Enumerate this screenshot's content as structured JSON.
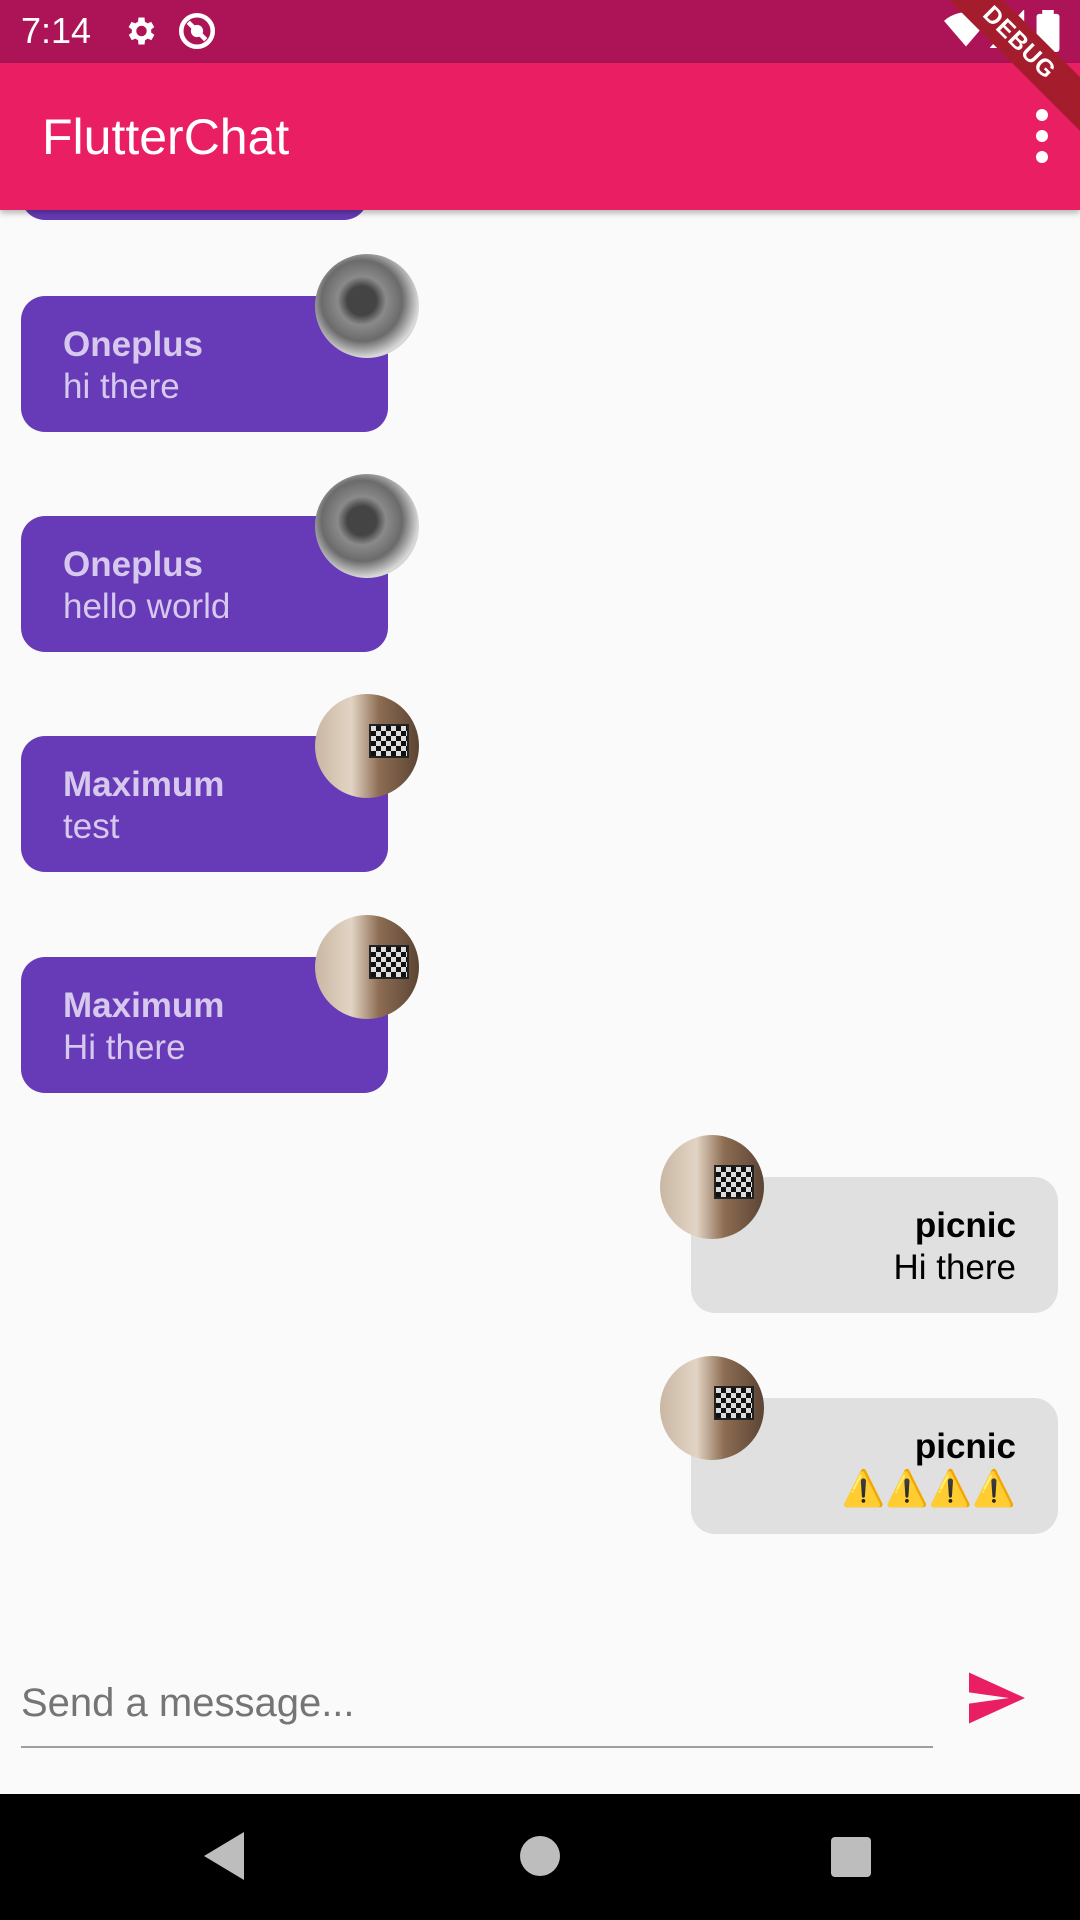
{
  "status_bar": {
    "time": "7:14",
    "icons": [
      "settings-icon",
      "sync-icon",
      "wifi-icon",
      "signal-icon",
      "battery-icon"
    ]
  },
  "debug_banner": "DEBUG",
  "app_bar": {
    "title": "FlutterChat",
    "menu_icon": "more-vert-icon"
  },
  "messages": [
    {
      "user": "Oneplus",
      "text": "hi there",
      "is_me": false,
      "avatar": "phone"
    },
    {
      "user": "Oneplus",
      "text": "hello world",
      "is_me": false,
      "avatar": "phone"
    },
    {
      "user": "Maximum",
      "text": "test",
      "is_me": false,
      "avatar": "room"
    },
    {
      "user": "Maximum",
      "text": "Hi there",
      "is_me": false,
      "avatar": "room"
    },
    {
      "user": "picnic",
      "text": "Hi there",
      "is_me": true,
      "avatar": "room"
    },
    {
      "user": "picnic",
      "text": "⚠️⚠️⚠️⚠️",
      "is_me": true,
      "avatar": "room"
    }
  ],
  "composer": {
    "placeholder": "Send a message...",
    "value": "",
    "send_icon": "send-icon"
  },
  "nav_bar": {
    "buttons": [
      "back-icon",
      "home-icon",
      "recents-icon"
    ]
  },
  "colors": {
    "status_bar": "#ad1457",
    "app_bar": "#e91e63",
    "other_bubble": "#673ab7",
    "my_bubble": "#e0e0e0",
    "send": "#e91e63"
  }
}
